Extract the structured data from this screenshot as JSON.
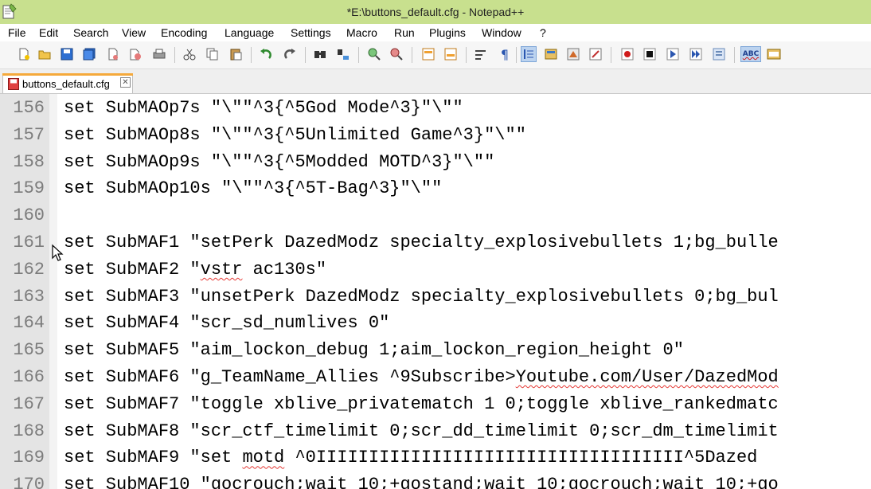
{
  "window": {
    "title": "*E:\\buttons_default.cfg - Notepad++"
  },
  "menu": [
    "File",
    "Edit",
    "Search",
    "View",
    "Encoding",
    "Language",
    "Settings",
    "Macro",
    "Run",
    "Plugins",
    "Window",
    "?"
  ],
  "toolbar": {
    "icons": [
      "new-file-icon",
      "open-file-icon",
      "save-icon",
      "save-all-icon",
      "close-icon",
      "close-all-icon",
      "print-icon",
      "cut-icon",
      "copy-icon",
      "paste-icon",
      "undo-icon",
      "redo-icon",
      "find-icon",
      "replace-icon",
      "zoom-in-icon",
      "zoom-out-icon",
      "sync-vertical-icon",
      "sync-horizontal-icon",
      "word-wrap-icon",
      "show-all-chars-icon",
      "indent-guide-icon",
      "user-defined-language-icon",
      "doc-map-icon",
      "function-list-icon",
      "record-macro-icon",
      "stop-record-icon",
      "play-macro-icon",
      "run-macro-multiple-icon",
      "save-macro-icon",
      "spell-check-icon",
      "spell-check-settings-icon"
    ],
    "spell_label": "ABC"
  },
  "tab": {
    "label": "buttons_default.cfg",
    "close_glyph": "✕"
  },
  "editor": {
    "lines": [
      {
        "num": "156",
        "code": "set SubMAOp7s \"\\\"\"^3{^5God Mode^3}\"\\\"\""
      },
      {
        "num": "157",
        "code": "set SubMAOp8s \"\\\"\"^3{^5Unlimited Game^3}\"\\\"\""
      },
      {
        "num": "158",
        "code": "set SubMAOp9s \"\\\"\"^3{^5Modded MOTD^3}\"\\\"\""
      },
      {
        "num": "159",
        "code": "set SubMAOp10s \"\\\"\"^3{^5T-Bag^3}\"\\\"\""
      },
      {
        "num": "160",
        "code": ""
      },
      {
        "num": "161",
        "code": "set SubMAF1 \"setPerk DazedModz specialty_explosivebullets 1;bg_bulle"
      },
      {
        "num": "162",
        "code": "set SubMAF2 \"vstr ac130s\"",
        "squiggle": "vstr"
      },
      {
        "num": "163",
        "code": "set SubMAF3 \"unsetPerk DazedModz specialty_explosivebullets 0;bg_bul"
      },
      {
        "num": "164",
        "code": "set SubMAF4 \"scr_sd_numlives 0\""
      },
      {
        "num": "165",
        "code": "set SubMAF5 \"aim_lockon_debug 1;aim_lockon_region_height 0\""
      },
      {
        "num": "166",
        "code": "set SubMAF6 \"g_TeamName_Allies ^9Subscribe>Youtube.com/User/DazedMod",
        "squiggle": "Youtube.com/User/DazedMod"
      },
      {
        "num": "167",
        "code": "set SubMAF7 \"toggle xblive_privatematch 1 0;toggle xblive_rankedmatc"
      },
      {
        "num": "168",
        "code": "set SubMAF8 \"scr_ctf_timelimit 0;scr_dd_timelimit 0;scr_dm_timelimit"
      },
      {
        "num": "169",
        "code": "set SubMAF9 \"set motd ^0IIIIIIIIIIIIIIIIIIIIIIIIIIIIIIIIIII^5Dazed",
        "squiggle": "motd"
      },
      {
        "num": "170",
        "code": "set SubMAF10 \"gocrouch;wait 10;+gostand;wait 10;gocrouch;wait 10;+go"
      }
    ]
  }
}
